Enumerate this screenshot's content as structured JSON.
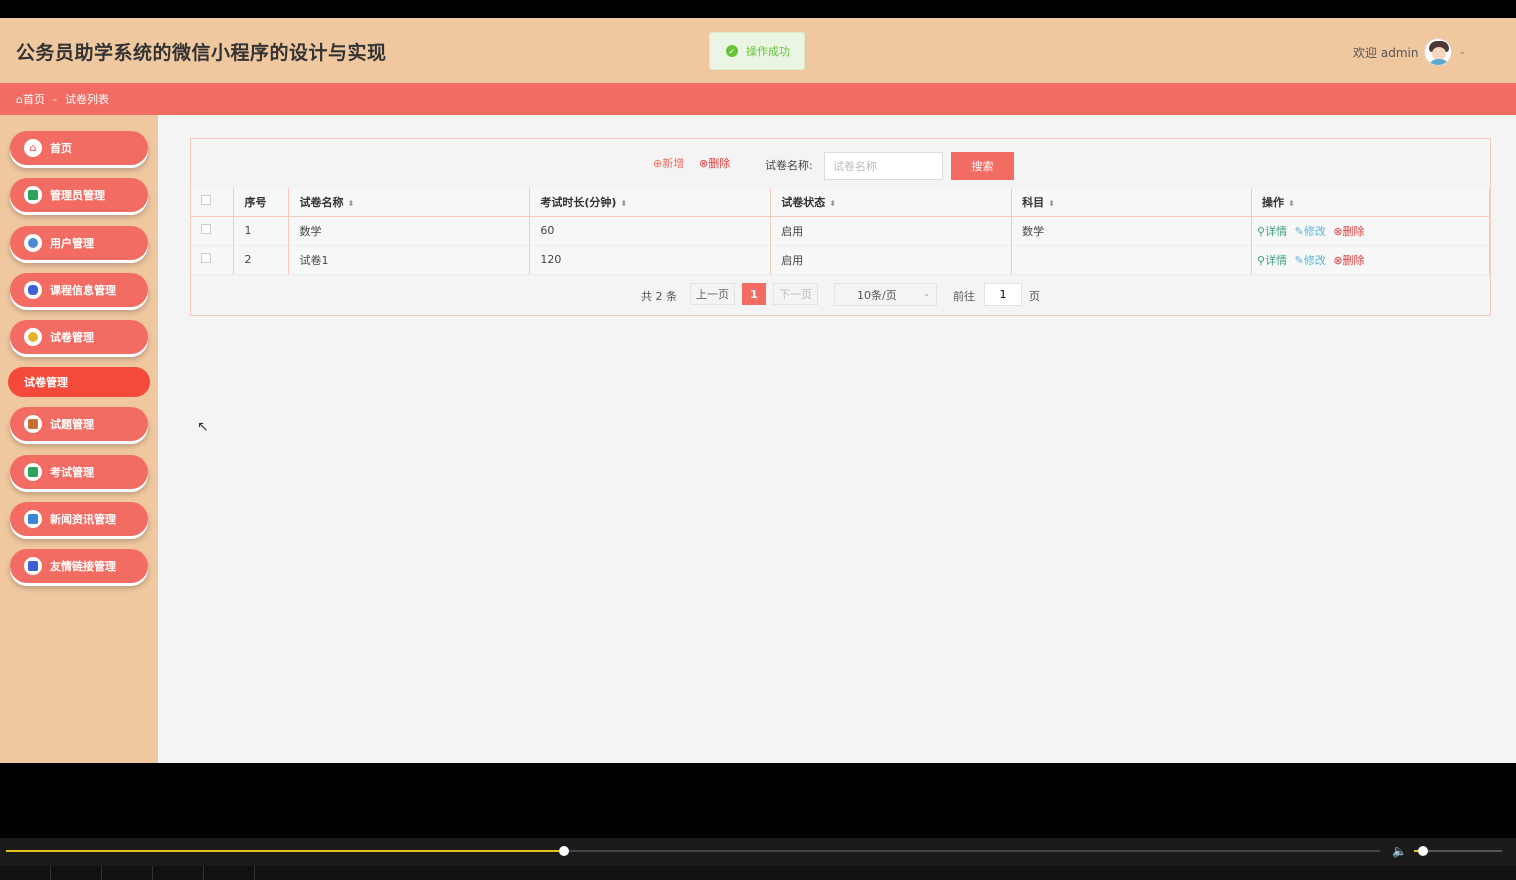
{
  "app": {
    "title": "公务员助学系统的微信小程序的设计与实现"
  },
  "toast": {
    "message": "操作成功"
  },
  "user": {
    "welcome": "欢迎 admin"
  },
  "breadcrumb": {
    "home": "首页",
    "separator": "-",
    "current": "试卷列表"
  },
  "sidebar": {
    "items": [
      {
        "label": "首页",
        "icon": "home-icon",
        "color": "#f36c63"
      },
      {
        "label": "管理员管理",
        "icon": "admin-icon",
        "color": "#2ea35a"
      },
      {
        "label": "用户管理",
        "icon": "user-icon",
        "color": "#4a8ad6"
      },
      {
        "label": "课程信息管理",
        "icon": "course-icon",
        "color": "#3f5ed8"
      },
      {
        "label": "试卷管理",
        "icon": "paper-icon",
        "color": "#e5b12a"
      },
      {
        "label": "试题管理",
        "icon": "question-icon",
        "color": "#c9702f"
      },
      {
        "label": "考试管理",
        "icon": "exam-icon",
        "color": "#2ea35a"
      },
      {
        "label": "新闻资讯管理",
        "icon": "news-icon",
        "color": "#3a86d9"
      },
      {
        "label": "友情链接管理",
        "icon": "link-icon",
        "color": "#3f5ed8"
      }
    ],
    "submenu": {
      "label": "试卷管理"
    }
  },
  "toolbar": {
    "add_label": "新增",
    "delete_label": "删除",
    "search_label": "试卷名称:",
    "search_placeholder": "试卷名称",
    "search_button": "搜索"
  },
  "table": {
    "headers": [
      "序号",
      "试卷名称",
      "考试时长(分钟)",
      "试卷状态",
      "科目",
      "操作"
    ],
    "rows": [
      {
        "index": "1",
        "name": "数学",
        "duration": "60",
        "status": "启用",
        "subject": "数学"
      },
      {
        "index": "2",
        "name": "试卷1",
        "duration": "120",
        "status": "启用",
        "subject": ""
      }
    ],
    "actions": {
      "detail": "详情",
      "edit": "修改",
      "delete": "删除"
    }
  },
  "pager": {
    "total": "共 2 条",
    "prev": "上一页",
    "current": "1",
    "next": "下一页",
    "page_size": "10条/页",
    "goto_label": "前往",
    "goto_value": "1",
    "page_label": "页"
  },
  "player": {
    "progress_fraction": 0.406,
    "volume_fraction": 0.1
  },
  "colors": {
    "accent": "#f36c63",
    "topbar": "#f0c8a0",
    "success": "#67c23a"
  }
}
